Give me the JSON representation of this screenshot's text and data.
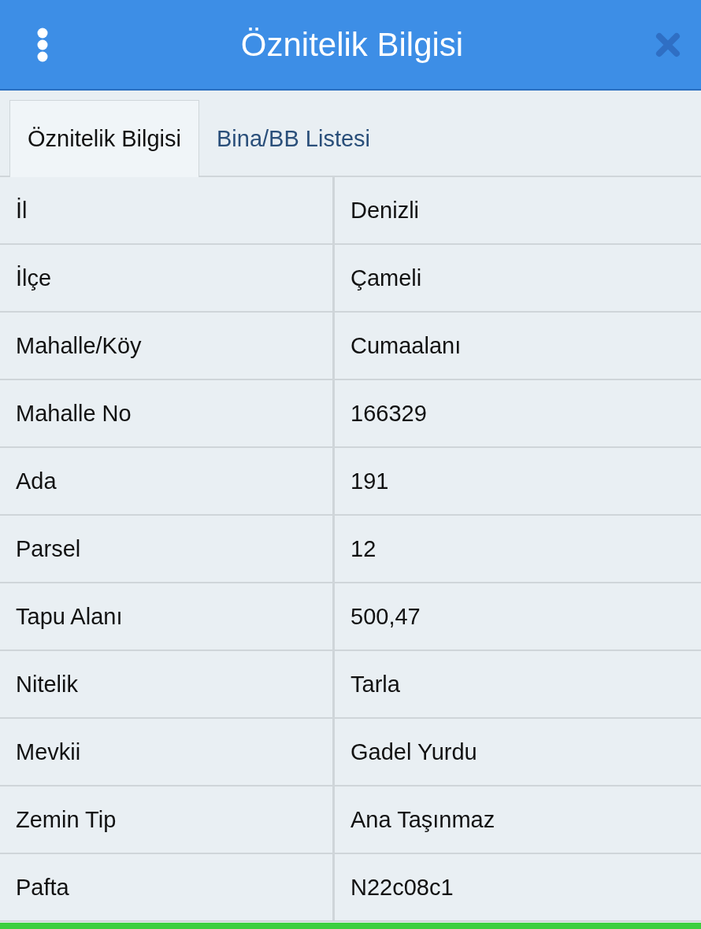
{
  "header": {
    "title": "Öznitelik Bilgisi"
  },
  "tabs": [
    {
      "label": "Öznitelik Bilgisi",
      "selected": true
    },
    {
      "label": "Bina/BB Listesi",
      "selected": false
    }
  ],
  "rows": [
    {
      "label": "İl",
      "value": "Denizli"
    },
    {
      "label": "İlçe",
      "value": "Çameli"
    },
    {
      "label": "Mahalle/Köy",
      "value": "Cumaalanı"
    },
    {
      "label": "Mahalle No",
      "value": "166329"
    },
    {
      "label": "Ada",
      "value": "191"
    },
    {
      "label": "Parsel",
      "value": "12"
    },
    {
      "label": "Tapu Alanı",
      "value": "500,47"
    },
    {
      "label": "Nitelik",
      "value": "Tarla"
    },
    {
      "label": "Mevkii",
      "value": "Gadel Yurdu"
    },
    {
      "label": "Zemin Tip",
      "value": "Ana Taşınmaz"
    },
    {
      "label": "Pafta",
      "value": "N22c08c1"
    }
  ]
}
